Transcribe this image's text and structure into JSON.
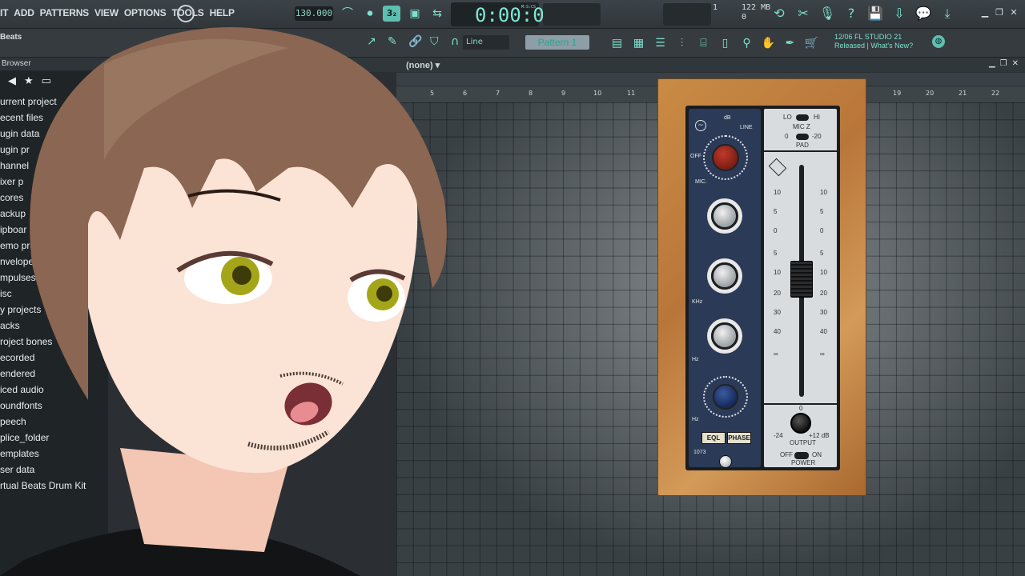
{
  "menu": [
    "IT",
    "ADD",
    "PATTERNS",
    "VIEW",
    "OPTIONS",
    "TOOLS",
    "HELP"
  ],
  "tempo": "130.000",
  "time": {
    "display": "0:00:00",
    "label": "M:S:CS"
  },
  "cpu": {
    "cores": "1",
    "memory": "122 MB",
    "polyphony": "0"
  },
  "toolbar2": {
    "beats_label": "Beats",
    "snap": "Line",
    "pattern": "Pattern 1"
  },
  "news": {
    "line1": "12/06  FL STUDIO 21",
    "line2": "Released | What's New?"
  },
  "browser": {
    "title": "Browser",
    "items": [
      "urrent project",
      "ecent files",
      "ugin data",
      "ugin pr",
      "hannel",
      "ixer p",
      "cores",
      "ackup",
      "ipboar",
      "emo pro",
      "nvelopes",
      "mpulses",
      "isc",
      "y projects",
      "acks",
      "roject bones",
      "ecorded",
      "endered",
      "iced audio",
      "oundfonts",
      "peech",
      "plice_folder",
      "emplates",
      "ser data",
      "rtual Beats Drum Kit"
    ]
  },
  "playlist": {
    "title": "(none)"
  },
  "ruler": [
    "5",
    "6",
    "7",
    "8",
    "9",
    "10",
    "11",
    "19",
    "20",
    "21",
    "22"
  ],
  "plugin": {
    "model": "1073",
    "mic_z": {
      "lo": "LO",
      "hi": "HI",
      "label": "MIC Z"
    },
    "pad": {
      "zero": "0",
      "minus20": "-20",
      "label": "PAD"
    },
    "input_labels": {
      "db": "dB",
      "line": "LINE",
      "mic": "MIC.",
      "off": "OFF"
    },
    "khz_label": "KHz",
    "hz_label": "Hz",
    "eql": "EQL",
    "phase": "PHASE",
    "fader_scale": [
      "10",
      "5",
      "0",
      "5",
      "10",
      "20",
      "30",
      "40",
      "∞"
    ],
    "output": {
      "label": "OUTPUT",
      "min": "-24",
      "max": "+12 dB",
      "zero": "0"
    },
    "power": {
      "off": "OFF",
      "on": "ON",
      "label": "POWER"
    }
  }
}
